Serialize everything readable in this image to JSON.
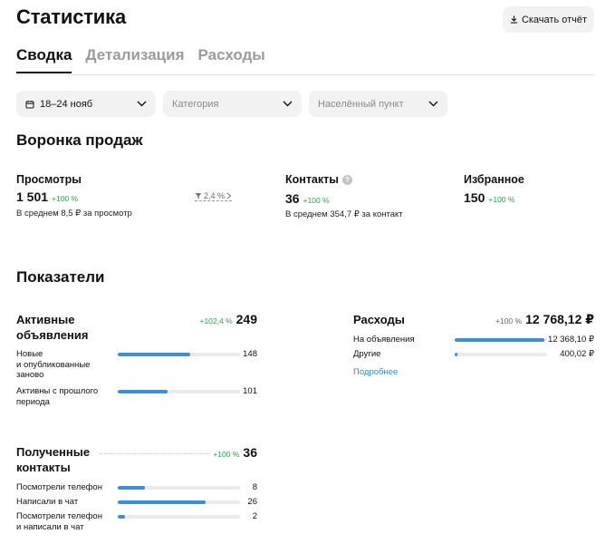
{
  "header": {
    "title": "Статистика",
    "download_label": "Скачать отчёт"
  },
  "tabs": [
    {
      "label": "Сводка",
      "active": true
    },
    {
      "label": "Детализация",
      "active": false
    },
    {
      "label": "Расходы",
      "active": false
    }
  ],
  "filters": {
    "period": "18–24 нояб",
    "category_placeholder": "Категория",
    "location_placeholder": "Населённый пункт"
  },
  "funnel": {
    "title": "Воронка продаж",
    "views": {
      "label": "Просмотры",
      "value": "1 501",
      "change": "+100 %",
      "sub": "В среднем 8,5 ₽ за просмотр"
    },
    "conversion": "2,4 %",
    "contacts": {
      "label": "Контакты",
      "value": "36",
      "change": "+100 %",
      "sub": "В среднем 354,7 ₽ за контакт"
    },
    "favorites": {
      "label": "Избранное",
      "value": "150",
      "change": "+100 %"
    }
  },
  "metrics": {
    "title": "Показатели",
    "active_ads": {
      "title_line1": "Активные",
      "title_line2": "объявления",
      "change": "+102,4 %",
      "total": "249",
      "rows": [
        {
          "label_lines": [
            "Новые",
            "и опубликованные",
            "заново"
          ],
          "value": "148",
          "fraction": 0.594
        },
        {
          "label_lines": [
            "Активны с прошлого",
            "периода"
          ],
          "value": "101",
          "fraction": 0.406
        }
      ]
    },
    "expenses": {
      "title": "Расходы",
      "change": "+100 %",
      "total": "12 768,12 ₽",
      "rows": [
        {
          "label": "На объявления",
          "value": "12 368,10 ₽",
          "fraction": 0.969
        },
        {
          "label": "Другие",
          "value": "400,02 ₽",
          "fraction": 0.031
        }
      ],
      "more_label": "Подробнее"
    },
    "received_contacts": {
      "title_line1": "Полученные",
      "title_line2": "контакты",
      "change": "+100 %",
      "total": "36",
      "rows": [
        {
          "label_lines": [
            "Посмотрели телефон"
          ],
          "value": "8",
          "fraction": 0.222
        },
        {
          "label_lines": [
            "Написали в чат"
          ],
          "value": "26",
          "fraction": 0.722
        },
        {
          "label_lines": [
            "Посмотрели телефон",
            "и написали в чат"
          ],
          "value": "2",
          "fraction": 0.056
        }
      ]
    }
  },
  "colors": {
    "accent_bar": "#3a8fd8",
    "positive": "#22a846",
    "link": "#2a8ad4",
    "control_bg": "#f2f2f2"
  },
  "icons": {
    "download": "download-icon",
    "calendar": "calendar-icon",
    "chevron": "chevron-down-icon",
    "help": "help-icon",
    "filter": "funnel-icon"
  }
}
